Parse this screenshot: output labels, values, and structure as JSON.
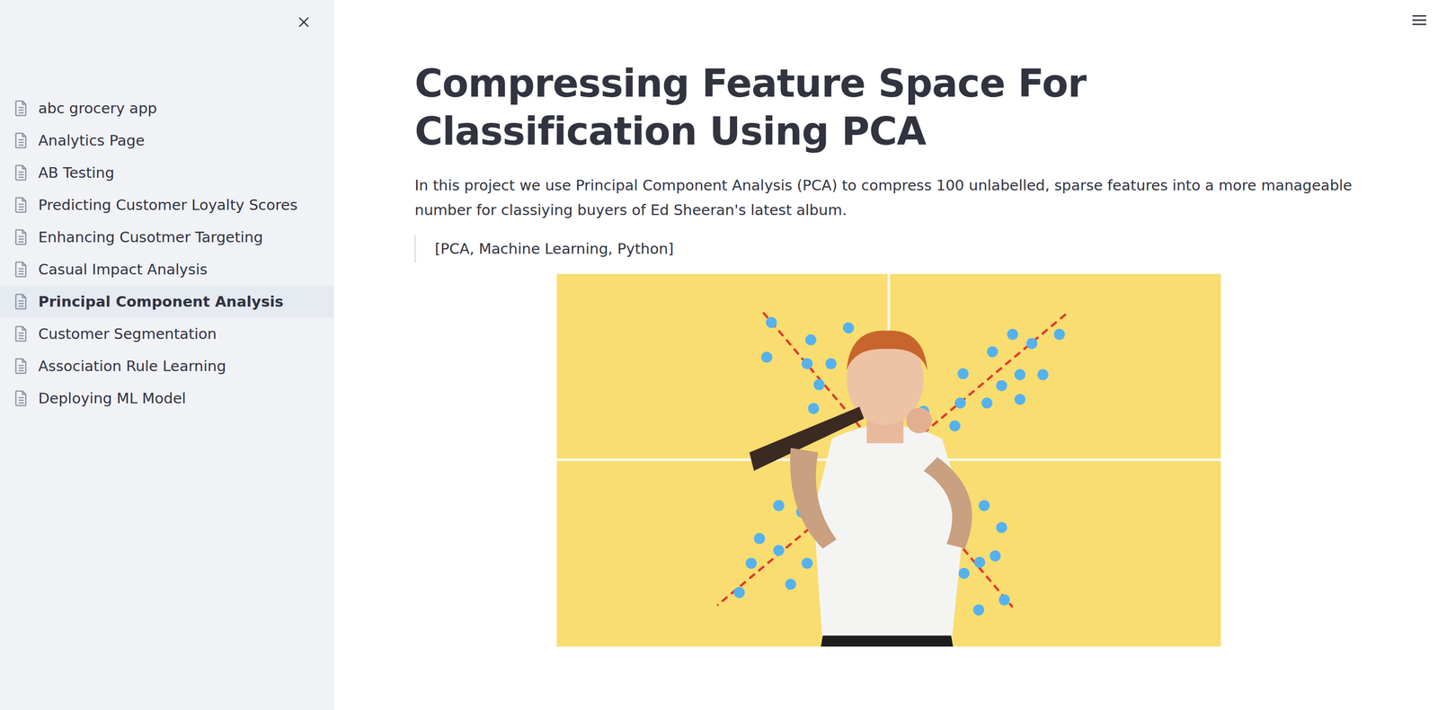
{
  "sidebar": {
    "items": [
      {
        "label": "abc grocery app",
        "selected": false
      },
      {
        "label": "Analytics Page",
        "selected": false
      },
      {
        "label": "AB Testing",
        "selected": false
      },
      {
        "label": "Predicting Customer Loyalty Scores",
        "selected": false
      },
      {
        "label": "Enhancing Cusotmer Targeting",
        "selected": false
      },
      {
        "label": "Casual Impact Analysis",
        "selected": false
      },
      {
        "label": "Principal Component Analysis",
        "selected": true
      },
      {
        "label": "Customer Segmentation",
        "selected": false
      },
      {
        "label": "Association Rule Learning",
        "selected": false
      },
      {
        "label": "Deploying ML Model",
        "selected": false
      }
    ]
  },
  "page": {
    "title": "Compressing Feature Space For Classification Using PCA",
    "description": "In this project we use Principal Component Analysis (PCA) to compress 100 unlabelled, sparse features into a more manageable number for classiying buyers of Ed Sheeran's latest album.",
    "tags": "[PCA, Machine Learning, Python]"
  }
}
